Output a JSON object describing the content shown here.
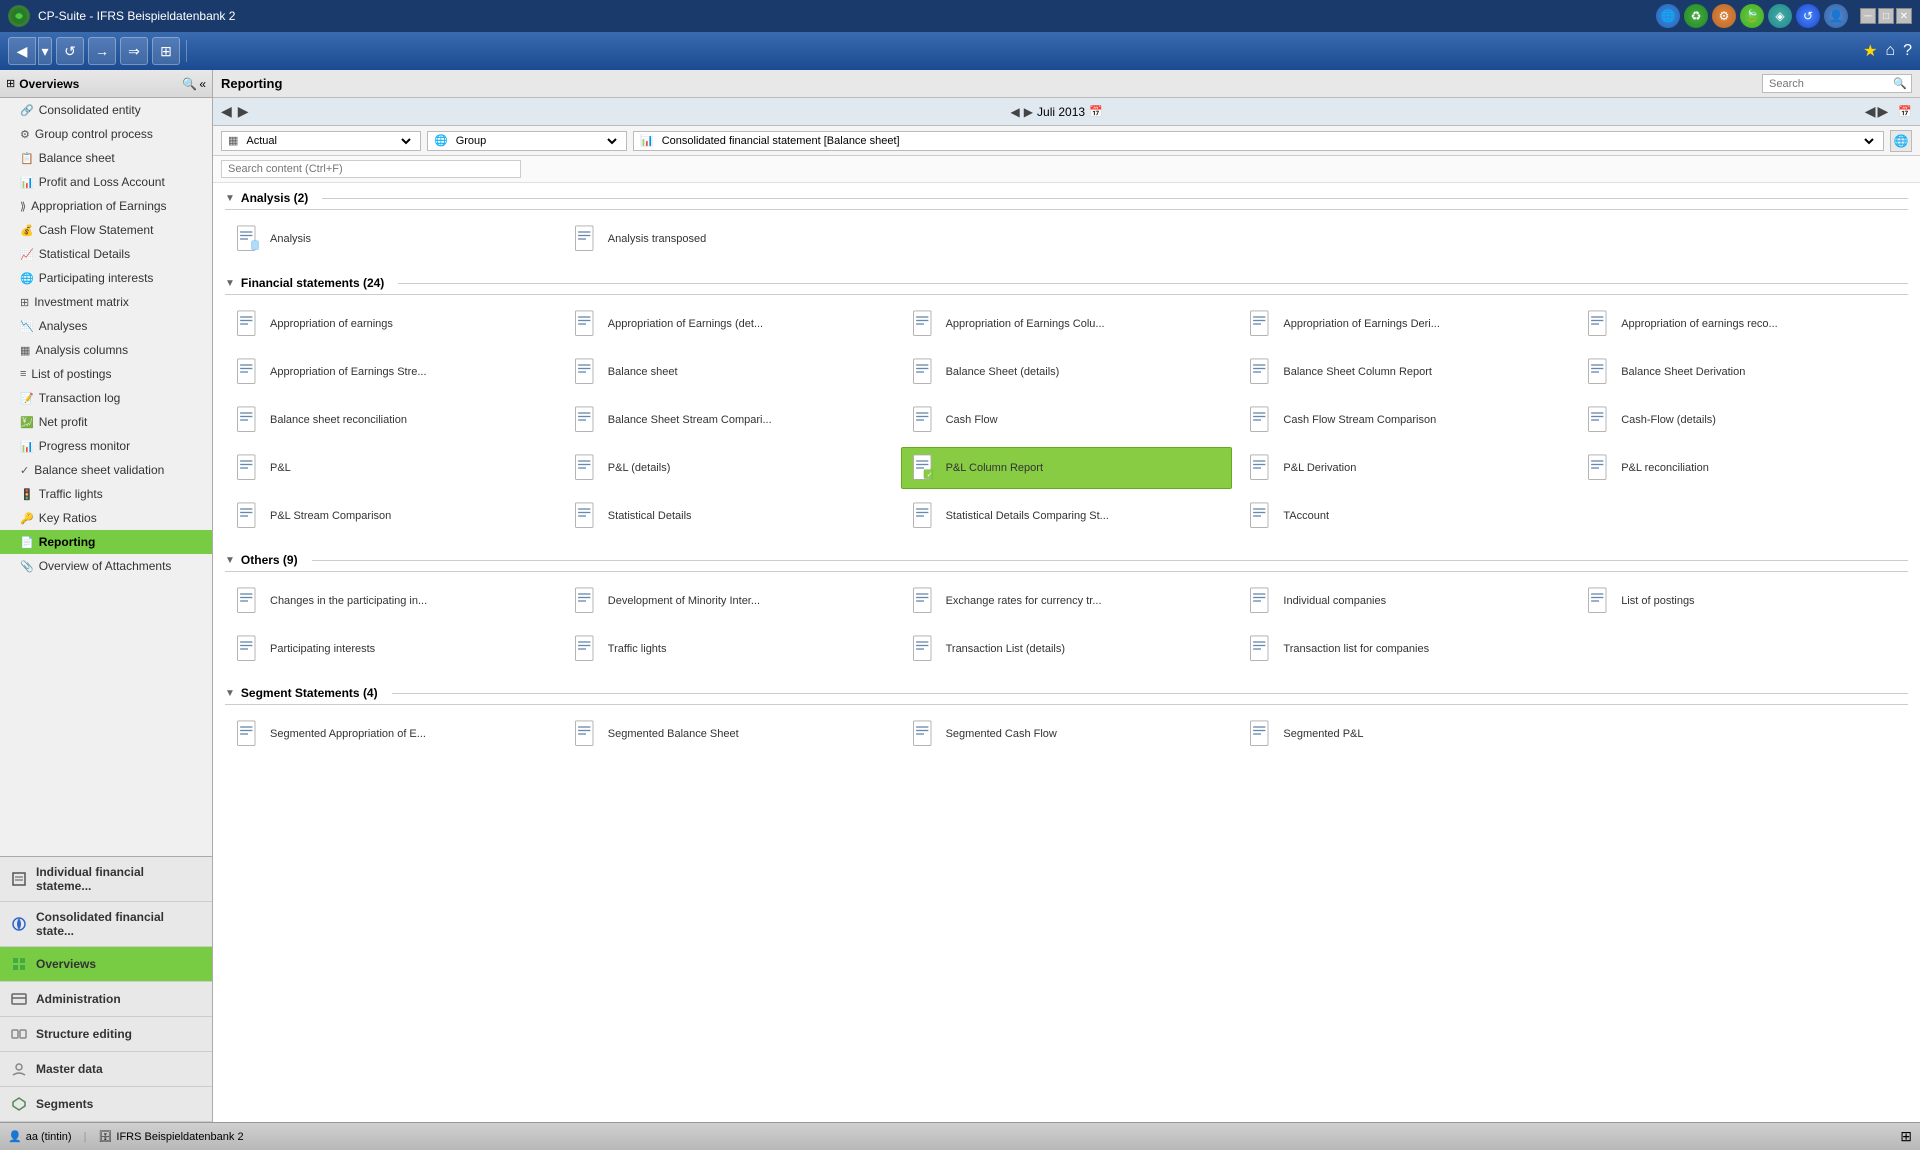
{
  "window": {
    "title": "CP-Suite - IFRS Beispieldatenbank 2"
  },
  "toolbar_icons": [
    "◀",
    "▶",
    "↺",
    "→",
    "⇒",
    "⊞"
  ],
  "top_right_icons": [
    "★",
    "⌂",
    "?"
  ],
  "content": {
    "title": "Reporting",
    "search_placeholder": "Search",
    "search_content_placeholder": "Search content (Ctrl+F)",
    "nav_month": "Juli 2013",
    "filter_actual": "Actual",
    "filter_group": "Group",
    "filter_report": "Consolidated financial statement [Balance sheet]"
  },
  "sidebar": {
    "header": "Overviews",
    "items": [
      {
        "id": "consolidated-entity",
        "label": "Consolidated entity",
        "icon": "🔗"
      },
      {
        "id": "group-control-process",
        "label": "Group control process",
        "icon": "⚙"
      },
      {
        "id": "balance-sheet",
        "label": "Balance sheet",
        "icon": "📋"
      },
      {
        "id": "profit-loss",
        "label": "Profit and Loss Account",
        "icon": "📊"
      },
      {
        "id": "appropriation",
        "label": "Appropriation of Earnings",
        "icon": "⟫"
      },
      {
        "id": "cash-flow",
        "label": "Cash Flow Statement",
        "icon": "💰"
      },
      {
        "id": "statistical-details",
        "label": "Statistical Details",
        "icon": "📈"
      },
      {
        "id": "participating-interests",
        "label": "Participating interests",
        "icon": "🌐"
      },
      {
        "id": "investment-matrix",
        "label": "Investment matrix",
        "icon": "⊞"
      },
      {
        "id": "analyses",
        "label": "Analyses",
        "icon": "📉"
      },
      {
        "id": "analysis-columns",
        "label": "Analysis columns",
        "icon": "▦"
      },
      {
        "id": "list-of-postings",
        "label": "List of postings",
        "icon": "≡"
      },
      {
        "id": "transaction-log",
        "label": "Transaction log",
        "icon": "📝"
      },
      {
        "id": "net-profit",
        "label": "Net profit",
        "icon": "💹"
      },
      {
        "id": "progress-monitor",
        "label": "Progress monitor",
        "icon": "📊"
      },
      {
        "id": "balance-sheet-validation",
        "label": "Balance sheet validation",
        "icon": "✓"
      },
      {
        "id": "traffic-lights",
        "label": "Traffic lights",
        "icon": "🚦"
      },
      {
        "id": "key-ratios",
        "label": "Key Ratios",
        "icon": "🔑"
      },
      {
        "id": "reporting",
        "label": "Reporting",
        "icon": "📄",
        "active": true
      },
      {
        "id": "overview-attachments",
        "label": "Overview of Attachments",
        "icon": "📎"
      }
    ]
  },
  "bottom_nav": [
    {
      "id": "individual-financial",
      "label": "Individual financial stateme...",
      "active": false
    },
    {
      "id": "consolidated-financial",
      "label": "Consolidated financial state...",
      "active": false
    },
    {
      "id": "overviews",
      "label": "Overviews",
      "active": true
    },
    {
      "id": "administration",
      "label": "Administration",
      "active": false
    },
    {
      "id": "structure-editing",
      "label": "Structure editing",
      "active": false
    },
    {
      "id": "master-data",
      "label": "Master data",
      "active": false
    },
    {
      "id": "segments",
      "label": "Segments",
      "active": false
    }
  ],
  "sections": [
    {
      "id": "analysis",
      "title": "Analysis (2)",
      "items": [
        {
          "id": "analysis",
          "name": "Analysis",
          "selected": false
        },
        {
          "id": "analysis-transposed",
          "name": "Analysis transposed",
          "selected": false
        }
      ]
    },
    {
      "id": "financial-statements",
      "title": "Financial statements (24)",
      "items": [
        {
          "id": "appropriation-earnings",
          "name": "Appropriation of earnings",
          "selected": false
        },
        {
          "id": "appropriation-earnings-det",
          "name": "Appropriation of Earnings (det...",
          "selected": false
        },
        {
          "id": "appropriation-earnings-colu",
          "name": "Appropriation of Earnings Colu...",
          "selected": false
        },
        {
          "id": "appropriation-earnings-deri",
          "name": "Appropriation of Earnings Deri...",
          "selected": false
        },
        {
          "id": "appropriation-earnings-reco",
          "name": "Appropriation of earnings reco...",
          "selected": false
        },
        {
          "id": "appropriation-earnings-stre",
          "name": "Appropriation of Earnings Stre...",
          "selected": false
        },
        {
          "id": "balance-sheet",
          "name": "Balance sheet",
          "selected": false
        },
        {
          "id": "balance-sheet-details",
          "name": "Balance Sheet (details)",
          "selected": false
        },
        {
          "id": "balance-sheet-column",
          "name": "Balance Sheet Column Report",
          "selected": false
        },
        {
          "id": "balance-sheet-derivation",
          "name": "Balance Sheet Derivation",
          "selected": false
        },
        {
          "id": "balance-sheet-reconciliation",
          "name": "Balance sheet reconciliation",
          "selected": false
        },
        {
          "id": "balance-sheet-stream-comp",
          "name": "Balance Sheet Stream Compari...",
          "selected": false
        },
        {
          "id": "cash-flow",
          "name": "Cash Flow",
          "selected": false
        },
        {
          "id": "cash-flow-stream-comp",
          "name": "Cash Flow Stream Comparison",
          "selected": false
        },
        {
          "id": "cash-flow-details",
          "name": "Cash-Flow (details)",
          "selected": false
        },
        {
          "id": "pl",
          "name": "P&L",
          "selected": false
        },
        {
          "id": "pl-details",
          "name": "P&L (details)",
          "selected": false
        },
        {
          "id": "pl-column-report",
          "name": "P&L Column Report",
          "selected": true
        },
        {
          "id": "pl-derivation",
          "name": "P&L Derivation",
          "selected": false
        },
        {
          "id": "pl-reconciliation",
          "name": "P&L reconciliation",
          "selected": false
        },
        {
          "id": "pl-stream-comparison",
          "name": "P&L Stream Comparison",
          "selected": false
        },
        {
          "id": "statistical-details",
          "name": "Statistical Details",
          "selected": false
        },
        {
          "id": "statistical-details-comparing",
          "name": "Statistical Details Comparing St...",
          "selected": false
        },
        {
          "id": "taccount",
          "name": "TAccount",
          "selected": false
        }
      ]
    },
    {
      "id": "others",
      "title": "Others (9)",
      "items": [
        {
          "id": "changes-participating",
          "name": "Changes in the participating in...",
          "selected": false
        },
        {
          "id": "development-minority",
          "name": "Development of Minority Inter...",
          "selected": false
        },
        {
          "id": "exchange-rates",
          "name": "Exchange rates for currency tr...",
          "selected": false
        },
        {
          "id": "individual-companies",
          "name": "Individual companies",
          "selected": false
        },
        {
          "id": "list-of-postings",
          "name": "List of postings",
          "selected": false
        },
        {
          "id": "participating-interests",
          "name": "Participating interests",
          "selected": false
        },
        {
          "id": "traffic-lights",
          "name": "Traffic lights",
          "selected": false
        },
        {
          "id": "transaction-list-details",
          "name": "Transaction List (details)",
          "selected": false
        },
        {
          "id": "transaction-list-companies",
          "name": "Transaction list for companies",
          "selected": false
        }
      ]
    },
    {
      "id": "segment-statements",
      "title": "Segment Statements (4)",
      "items": [
        {
          "id": "segmented-appropriation",
          "name": "Segmented Appropriation of E...",
          "selected": false
        },
        {
          "id": "segmented-balance-sheet",
          "name": "Segmented Balance Sheet",
          "selected": false
        },
        {
          "id": "segmented-cash-flow",
          "name": "Segmented Cash Flow",
          "selected": false
        },
        {
          "id": "segmented-pl",
          "name": "Segmented P&L",
          "selected": false
        }
      ]
    }
  ],
  "status_bar": {
    "user": "aa (tintin)",
    "db": "IFRS Beispieldatenbank 2"
  }
}
